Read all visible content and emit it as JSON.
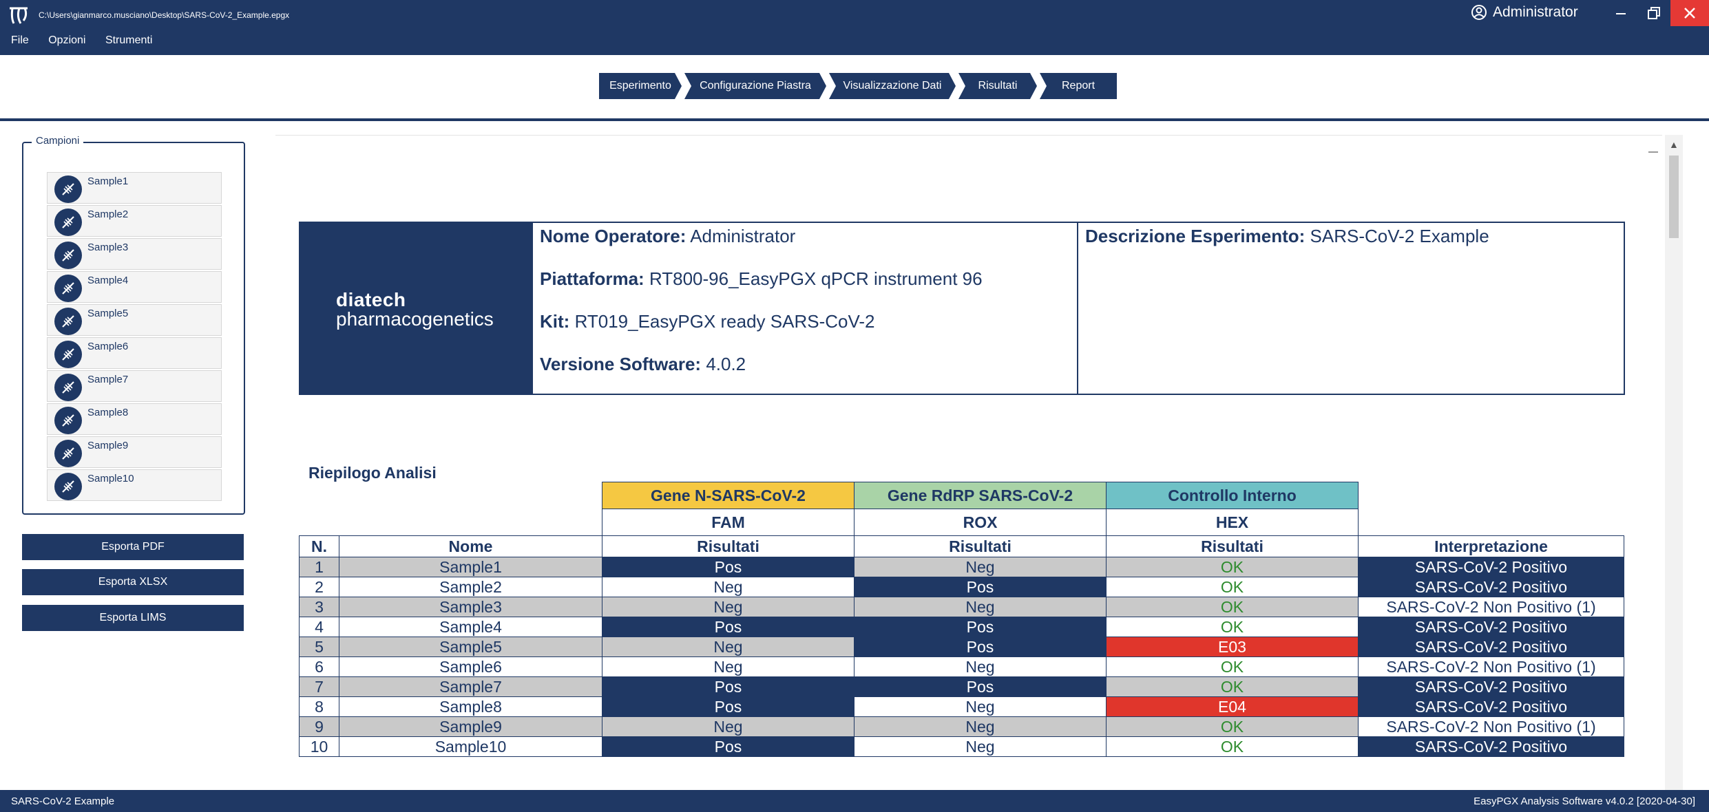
{
  "window": {
    "path": "C:\\Users\\gianmarco.musciano\\Desktop\\SARS-CoV-2_Example.epgx",
    "user": "Administrator",
    "icons": {
      "app": "app-logo-icon",
      "user": "user-circle-icon",
      "minimize": "minimize-icon",
      "maximize": "maximize-icon",
      "close": "close-icon"
    },
    "close_color": "#e53935"
  },
  "menu": {
    "file": "File",
    "opzioni": "Opzioni",
    "strumenti": "Strumenti"
  },
  "steps": [
    "Esperimento",
    "Configurazione Piastra",
    "Visualizzazione Dati",
    "Risultati",
    "Report"
  ],
  "sidebar": {
    "legend": "Campioni",
    "samples": [
      "Sample1",
      "Sample2",
      "Sample3",
      "Sample4",
      "Sample5",
      "Sample6",
      "Sample7",
      "Sample8",
      "Sample9",
      "Sample10"
    ],
    "sample_icon": "dna-icon",
    "buttons": {
      "pdf": "Esporta PDF",
      "xlsx": "Esporta XLSX",
      "lims": "Esporta LIMS"
    }
  },
  "report": {
    "logo_top": "diatech",
    "logo_bottom": "pharmacogenetics",
    "operator_label": "Nome Operatore:",
    "operator_value": "Administrator",
    "platform_label": "Piattaforma:",
    "platform_value": "RT800-96_EasyPGX qPCR instrument 96",
    "kit_label": "Kit:",
    "kit_value": "RT019_EasyPGX ready SARS-CoV-2",
    "software_label": "Versione Software:",
    "software_value": "4.0.2",
    "desc_label": "Descrizione Esperimento:",
    "desc_value": "SARS-CoV-2 Example",
    "summary_title": "Riepilogo Analisi",
    "genes": [
      {
        "name": "Gene N-SARS-CoV-2",
        "channel": "FAM",
        "color": "#f5c842"
      },
      {
        "name": "Gene RdRP SARS-CoV-2",
        "channel": "ROX",
        "color": "#a9d3a7"
      },
      {
        "name": "Controllo Interno",
        "channel": "HEX",
        "color": "#6fc1c6"
      }
    ],
    "col_n": "N.",
    "col_name": "Nome",
    "col_results": "Risultati",
    "col_interp": "Interpretazione",
    "rows": [
      {
        "n": "1",
        "name": "Sample1",
        "fam": "Pos",
        "rox": "Neg",
        "hex": "OK",
        "interp": "SARS-CoV-2 Positivo"
      },
      {
        "n": "2",
        "name": "Sample2",
        "fam": "Neg",
        "rox": "Pos",
        "hex": "OK",
        "interp": "SARS-CoV-2 Positivo"
      },
      {
        "n": "3",
        "name": "Sample3",
        "fam": "Neg",
        "rox": "Neg",
        "hex": "OK",
        "interp": "SARS-CoV-2 Non Positivo (1)"
      },
      {
        "n": "4",
        "name": "Sample4",
        "fam": "Pos",
        "rox": "Pos",
        "hex": "OK",
        "interp": "SARS-CoV-2 Positivo"
      },
      {
        "n": "5",
        "name": "Sample5",
        "fam": "Neg",
        "rox": "Pos",
        "hex": "E03",
        "interp": "SARS-CoV-2 Positivo"
      },
      {
        "n": "6",
        "name": "Sample6",
        "fam": "Neg",
        "rox": "Neg",
        "hex": "OK",
        "interp": "SARS-CoV-2 Non Positivo (1)"
      },
      {
        "n": "7",
        "name": "Sample7",
        "fam": "Pos",
        "rox": "Pos",
        "hex": "OK",
        "interp": "SARS-CoV-2 Positivo"
      },
      {
        "n": "8",
        "name": "Sample8",
        "fam": "Pos",
        "rox": "Neg",
        "hex": "E04",
        "interp": "SARS-CoV-2 Positivo"
      },
      {
        "n": "9",
        "name": "Sample9",
        "fam": "Neg",
        "rox": "Neg",
        "hex": "OK",
        "interp": "SARS-CoV-2 Non Positivo (1)"
      },
      {
        "n": "10",
        "name": "Sample10",
        "fam": "Pos",
        "rox": "Neg",
        "hex": "OK",
        "interp": "SARS-CoV-2 Positivo"
      }
    ]
  },
  "status": {
    "left": "SARS-CoV-2 Example",
    "right": "EasyPGX Analysis Software v4.0.2 [2020-04-30]"
  }
}
